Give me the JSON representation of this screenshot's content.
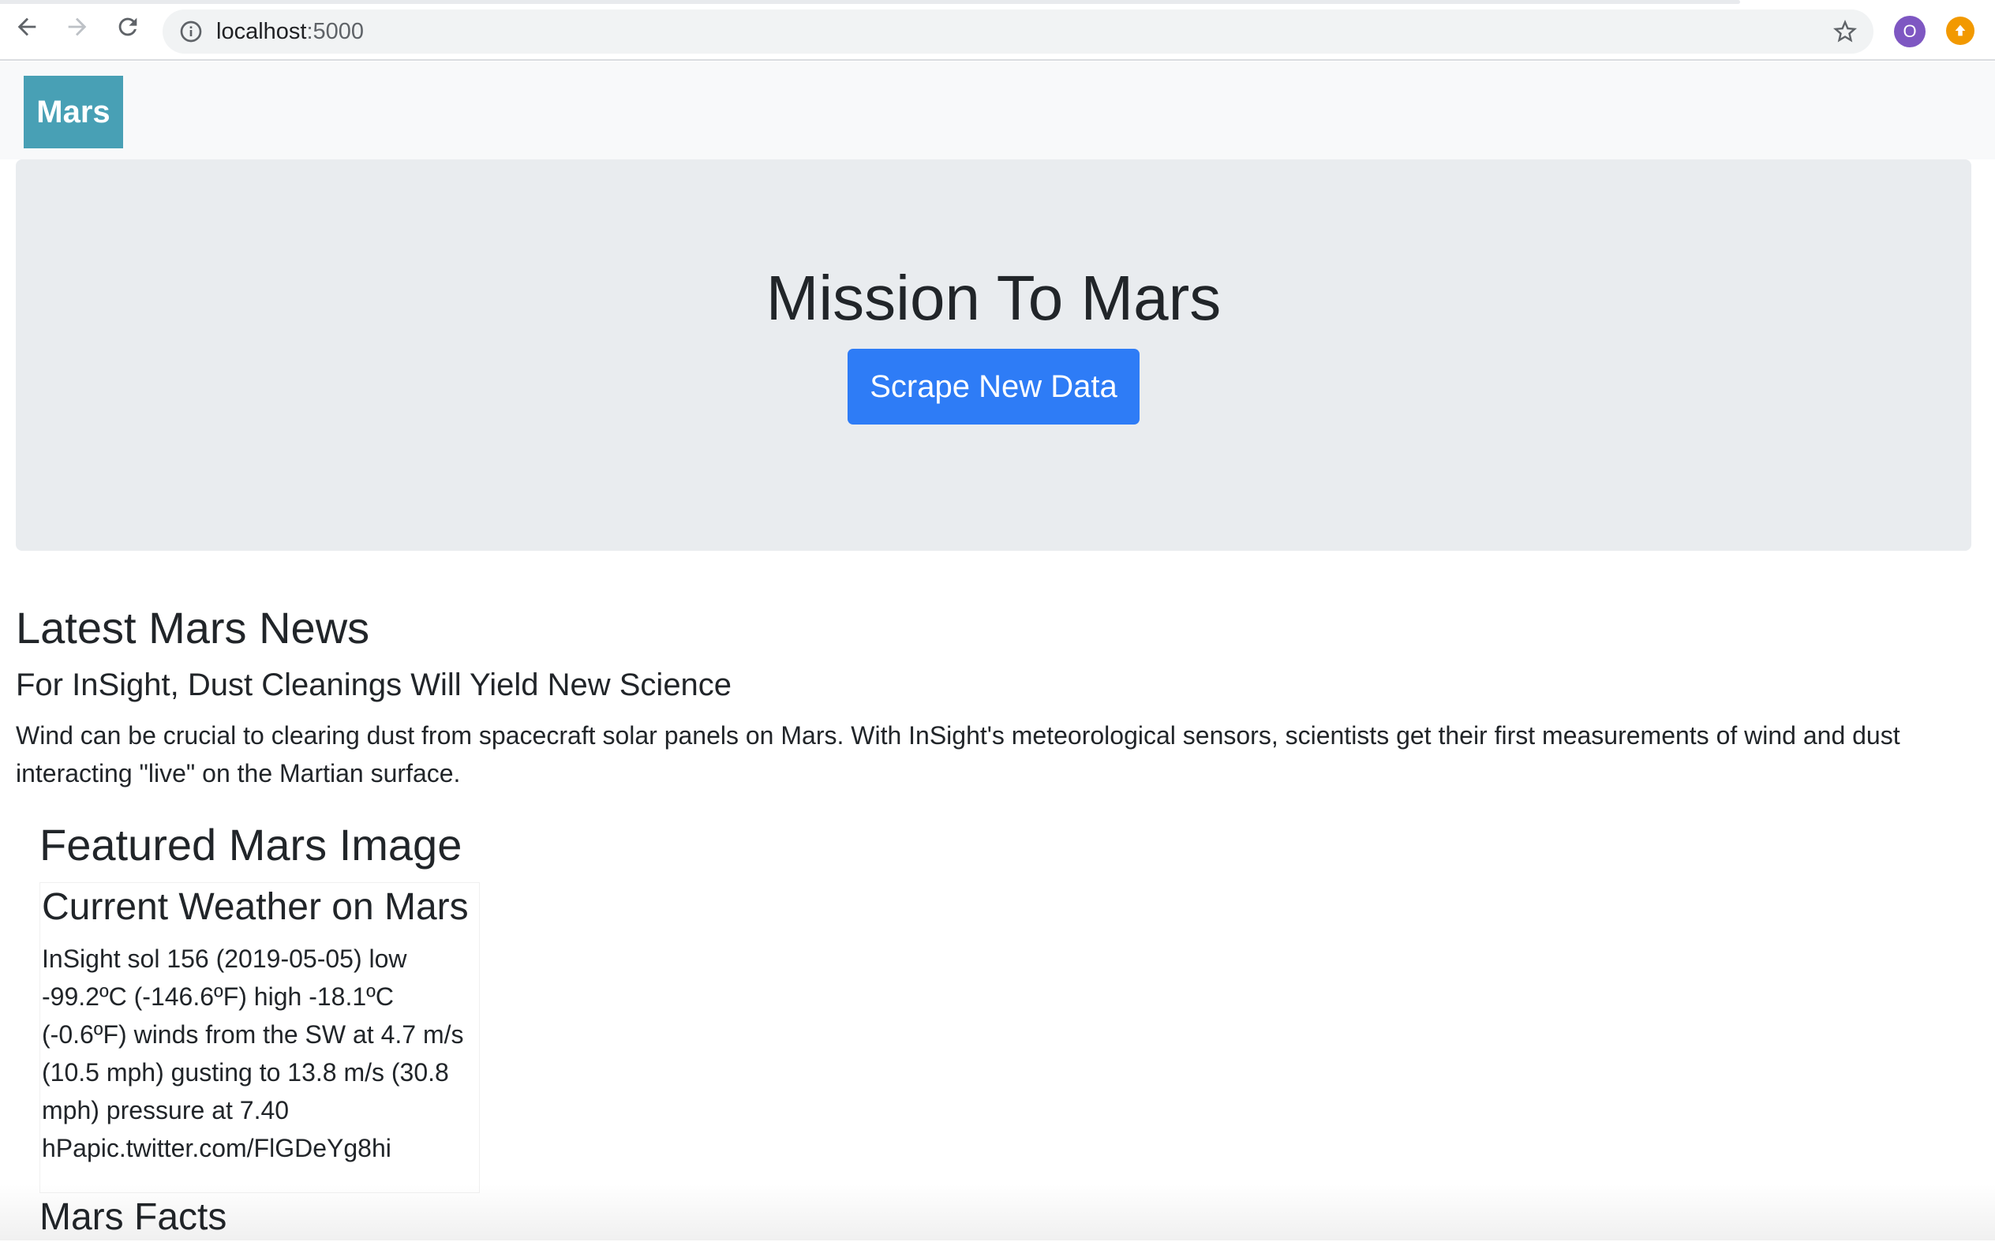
{
  "browser": {
    "url_host": "localhost",
    "url_port": ":5000",
    "profile_initial": "O"
  },
  "navbar": {
    "brand": "Mars"
  },
  "jumbotron": {
    "title": "Mission To Mars",
    "button_label": "Scrape New Data",
    "button_color": "#2e7cf6"
  },
  "news": {
    "heading": "Latest Mars News",
    "title": "For InSight, Dust Cleanings Will Yield New Science",
    "body": "Wind can be crucial to clearing dust from spacecraft solar panels on Mars. With InSight's meteorological sensors, scientists get their first measurements of wind and dust interacting \"live\" on the Martian surface."
  },
  "featured": {
    "heading": "Featured Mars Image"
  },
  "weather": {
    "heading": "Current Weather on Mars",
    "text": "InSight sol 156 (2019-05-05) low -99.2ºC (-146.6ºF) high -18.1ºC (-0.6ºF) winds from the SW at 4.7 m/s (10.5 mph) gusting to 13.8 m/s (30.8 mph) pressure at 7.40 hPapic.twitter.com/FlGDeYg8hi"
  },
  "facts": {
    "heading": "Mars Facts"
  },
  "colors": {
    "brand_bg": "#48a0b5",
    "jumbotron_bg": "#e9ecef",
    "navbar_bg": "#f8f9fa"
  }
}
